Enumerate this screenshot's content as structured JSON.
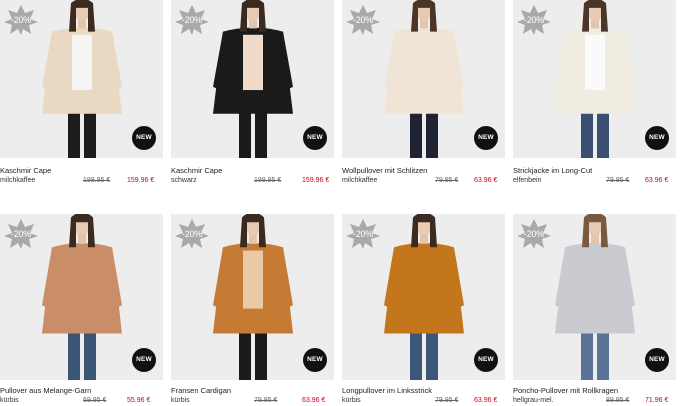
{
  "products": [
    {
      "name": "Kaschmir Cape",
      "color": "milchkaffee",
      "old_price": "199.95 €",
      "new_price": "159.96 €",
      "discount": "-20%",
      "badge": "NEW",
      "garment": "#ead9c2",
      "inner": "#f4f4f2",
      "legs": "#1c1c1c",
      "hair": "#3b2a20"
    },
    {
      "name": "Kaschmir Cape",
      "color": "schwarz",
      "old_price": "199.95 €",
      "new_price": "159.96 €",
      "discount": "-20%",
      "badge": "NEW",
      "garment": "#1a1a1a",
      "inner": "#efd9c8",
      "legs": "#1a1a1a",
      "hair": "#3b2a20"
    },
    {
      "name": "Wollpullover mit Schlitzen",
      "color": "milchkaffee",
      "old_price": "79.95 €",
      "new_price": "63.96 €",
      "discount": "-20%",
      "badge": "NEW",
      "garment": "#f0e4d6",
      "inner": "#f0e4d6",
      "legs": "#1e2233",
      "hair": "#4a3526"
    },
    {
      "name": "Strickjacke im Long-Cut",
      "color": "elfenbein",
      "old_price": "79.95 €",
      "new_price": "63.96 €",
      "discount": "-20%",
      "badge": "NEW",
      "garment": "#f1ece0",
      "inner": "#fafafa",
      "legs": "#3a4f72",
      "hair": "#4a3526"
    },
    {
      "name": "Pullover aus Melange-Garn",
      "color": "kürbis",
      "old_price": "69.95 €",
      "new_price": "55.96 €",
      "discount": "-20%",
      "badge": "NEW",
      "garment": "#c98e68",
      "inner": "#c98e68",
      "legs": "#3d5577",
      "hair": "#3b2a20"
    },
    {
      "name": "Fransen Cardigan",
      "color": "kürbis",
      "old_price": "79.95 €",
      "new_price": "63.96 €",
      "discount": "-20%",
      "badge": "NEW",
      "garment": "#c67b34",
      "inner": "#e9c9a6",
      "legs": "#1b1b1b",
      "hair": "#3b2a20"
    },
    {
      "name": "Longpullover im Linksstrick",
      "color": "kürbis",
      "old_price": "79.95 €",
      "new_price": "63.96 €",
      "discount": "-20%",
      "badge": "NEW",
      "garment": "#c4761c",
      "inner": "#c4761c",
      "legs": "#3d5577",
      "hair": "#3b2a20"
    },
    {
      "name": "Poncho-Pullover mit Rollkragen",
      "color": "hellgrau-mel.",
      "old_price": "89.95 €",
      "new_price": "71.96 €",
      "discount": "-20%",
      "badge": "NEW",
      "garment": "#c9cbd0",
      "inner": "#c9cbd0",
      "legs": "#5a7396",
      "hair": "#7a5a3e"
    }
  ],
  "colors": {
    "image_bg": "#ededed",
    "discount_badge": "#a9a9a9",
    "sale_price": "#d0021b"
  }
}
